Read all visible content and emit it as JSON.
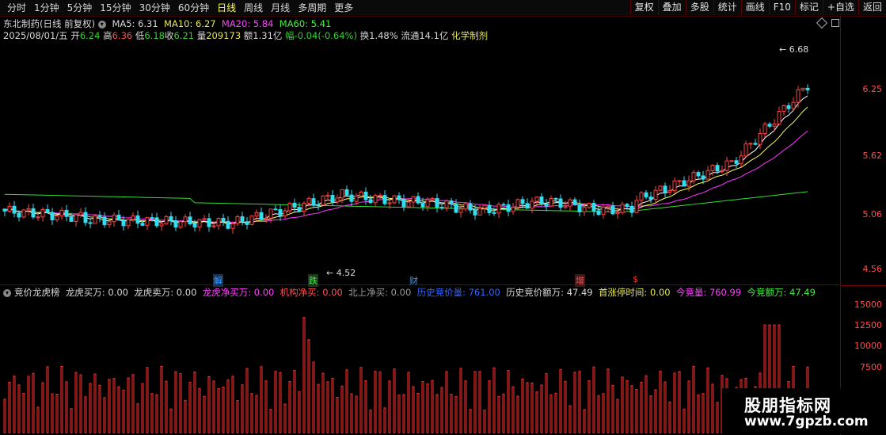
{
  "toolbar": {
    "periods": [
      "分时",
      "1分钟",
      "5分钟",
      "15分钟",
      "30分钟",
      "60分钟",
      "日线",
      "周线",
      "月线",
      "多周期",
      "更多"
    ],
    "active_index": 6,
    "right_buttons": [
      "复权",
      "叠加",
      "多股",
      "统计",
      "画线",
      "F10",
      "标记",
      "+自选",
      "返回"
    ]
  },
  "info": {
    "stock": "东北制药(日线 前复权)",
    "ma5": "MA5: 6.31",
    "ma10": "MA10: 6.27",
    "ma20": "MA20: 5.84",
    "ma60": "MA60: 5.41",
    "date": "2025/08/01/五",
    "open_label": "开",
    "open": "6.24",
    "high_label": "高",
    "high": "6.36",
    "low_label": "低",
    "low": "6.18",
    "close_label": "收",
    "close": "6.21",
    "vol_label": "量",
    "vol": "209173",
    "amt": "额1.31亿",
    "chg": "幅-0.04(-0.64%)",
    "turnover": "换1.48%",
    "float": "流通14.1亿",
    "sector": "化学制剂"
  },
  "price_axis": [
    "6.25",
    "5.62",
    "5.06",
    "4.56"
  ],
  "price_marks": {
    "high": "6.68",
    "low": "4.52"
  },
  "events": [
    {
      "label": "解",
      "color": "#3399ff"
    },
    {
      "label": "跌",
      "color": "#44ee44"
    },
    {
      "label": "财",
      "color": "#3399ff"
    },
    {
      "label": "增",
      "color": "#ff5050"
    },
    {
      "label": "$",
      "color": "#ff3030"
    }
  ],
  "indicator": {
    "name": "竞价龙虎榜",
    "f1": "龙虎买万: 0.00",
    "f2": "龙虎卖万: 0.00",
    "f3": "龙虎净买万: 0.00",
    "f4": "机构净买: 0.00",
    "f5": "北上净买: 0.00",
    "f6": "历史竞价量: 761.00",
    "f7": "历史竞价额万: 47.49",
    "f8": "首涨停时间: 0.00",
    "f9": "今竞量: 760.99",
    "f10": "今竞额万: 47.49"
  },
  "sub_axis": [
    "15000",
    "12500",
    "10000",
    "7500"
  ],
  "watermark": {
    "title": "股朋指标网",
    "url": "www.7gpzb.com"
  },
  "colors": {
    "up": "#ff4040",
    "down": "#33ddee",
    "ma5": "#ffffff",
    "ma10": "#ffff66",
    "ma20": "#ff33ff",
    "ma60": "#33dd33"
  }
}
